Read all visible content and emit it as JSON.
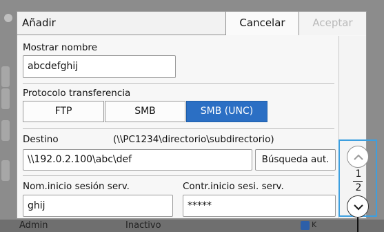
{
  "dialog": {
    "title": "Añadir",
    "cancel_label": "Cancelar",
    "ok_label": "Aceptar"
  },
  "display_name": {
    "label": "Mostrar nombre",
    "value": "abcdefghij"
  },
  "protocol": {
    "label": "Protocolo transferencia",
    "options": [
      "FTP",
      "SMB",
      "SMB (UNC)"
    ],
    "selected": "SMB (UNC)"
  },
  "destination": {
    "label": "Destino",
    "hint": "(\\\\PC1234\\directorio\\subdirectorio)",
    "value": "\\\\192.0.2.100\\abc\\def",
    "search_label": "Búsqueda aut."
  },
  "login_name": {
    "label": "Nom.inicio sesión serv.",
    "value": "ghij"
  },
  "login_password": {
    "label": "Contr.inicio sesi. serv.",
    "value": "*****"
  },
  "pager": {
    "current": "1",
    "total": "2"
  },
  "background": {
    "user": "Admin",
    "status": "Inactivo"
  },
  "colors": {
    "accent": "#2b6fc4",
    "highlight": "#3d9fdf"
  }
}
